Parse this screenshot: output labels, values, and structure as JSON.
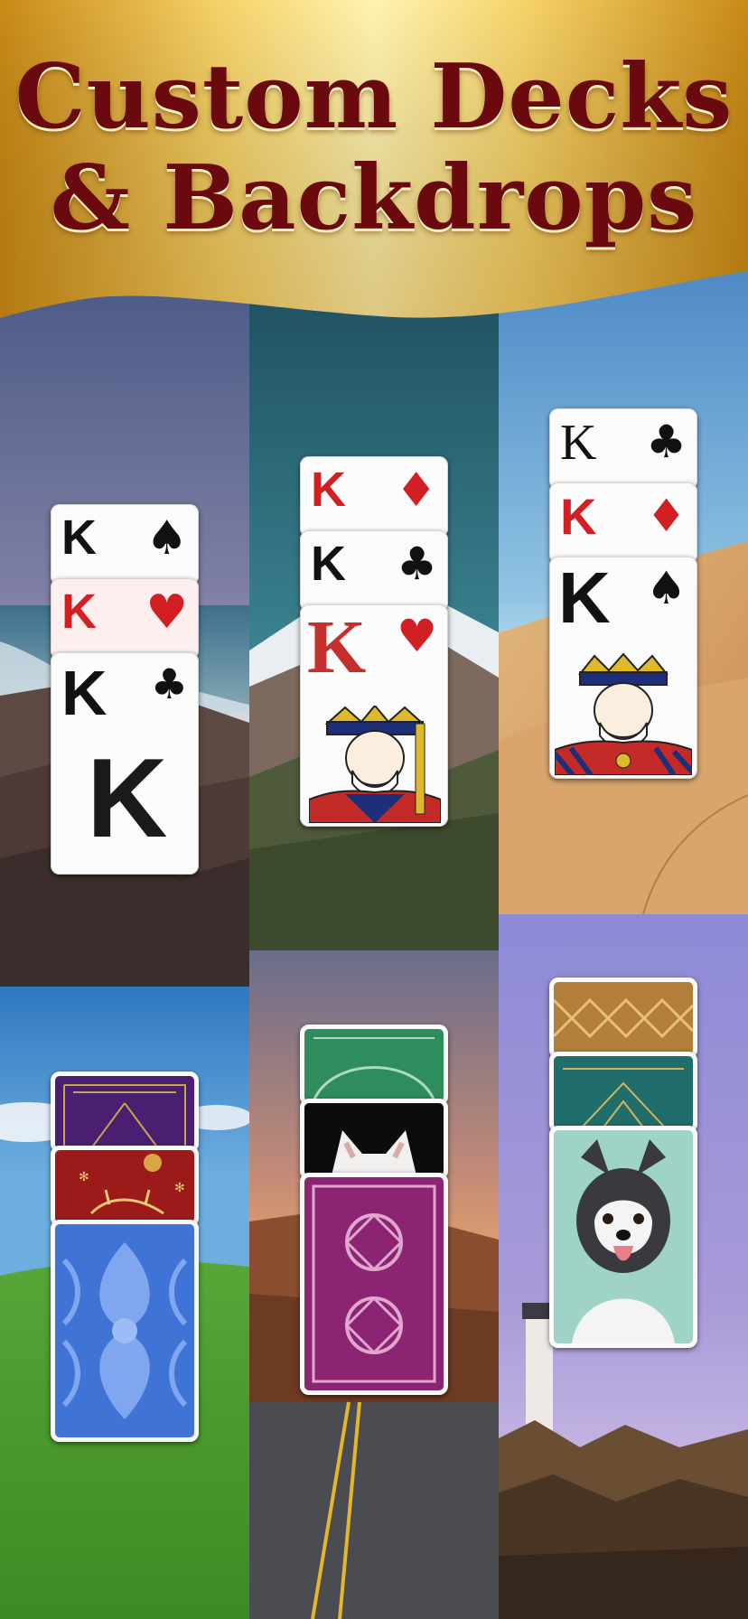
{
  "header": {
    "title_line1": "Custom Decks",
    "title_line2": "& Backdrops"
  },
  "colors": {
    "title_text": "#6b0a0e",
    "banner_gold_light": "#fff3b0",
    "banner_gold_dark": "#c98a16",
    "card_red": "#d21f24",
    "card_black": "#111111"
  },
  "backdrops": [
    {
      "name": "rocky-coast"
    },
    {
      "name": "snowy-mountains"
    },
    {
      "name": "desert-dunes"
    },
    {
      "name": "green-meadow"
    },
    {
      "name": "canyon-road"
    },
    {
      "name": "lighthouse-rocks"
    }
  ],
  "decks": {
    "deck1": [
      {
        "rank": "K",
        "suit": "♠",
        "color": "black"
      },
      {
        "rank": "K",
        "suit": "♥",
        "color": "red"
      },
      {
        "rank": "K",
        "suit": "♣",
        "color": "black",
        "center": "K"
      }
    ],
    "deck2": [
      {
        "rank": "K",
        "suit": "♦",
        "color": "red"
      },
      {
        "rank": "K",
        "suit": "♣",
        "color": "black"
      },
      {
        "rank": "K",
        "suit": "♥",
        "color": "red",
        "face": "king-portrait-icon"
      }
    ],
    "deck3": [
      {
        "rank": "K",
        "suit": "♣",
        "color": "black"
      },
      {
        "rank": "K",
        "suit": "♦",
        "color": "red"
      },
      {
        "rank": "K",
        "suit": "♠",
        "color": "black",
        "face": "king-portrait-icon"
      }
    ]
  },
  "card_backs": {
    "deck4": [
      "purple-art-deco",
      "red-snowflake",
      "blue-damask"
    ],
    "deck5": [
      "green-ornate",
      "white-kitten-photo",
      "magenta-mandala"
    ],
    "deck6": [
      "gold-lattice",
      "teal-art-deco",
      "husky-photo"
    ]
  }
}
